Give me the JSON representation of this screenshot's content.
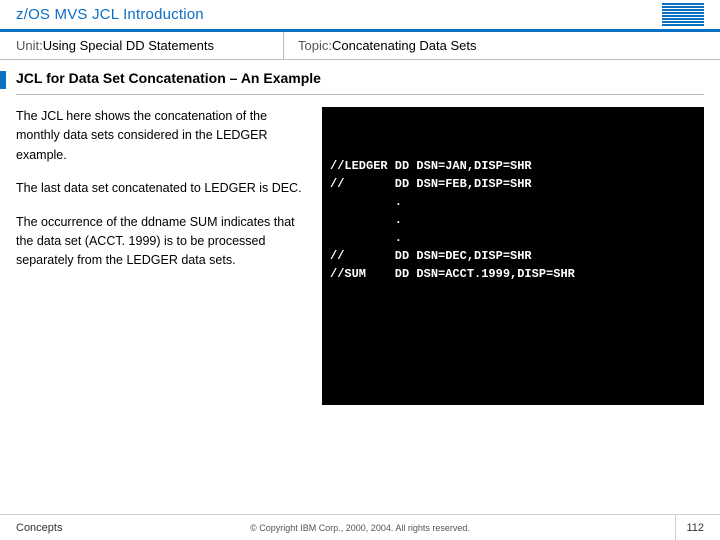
{
  "header": {
    "title": "z/OS MVS JCL Introduction"
  },
  "subtitle": {
    "unit_label": "Unit: ",
    "unit_value": "Using Special DD Statements",
    "topic_label": "Topic: ",
    "topic_value": "Concatenating Data Sets"
  },
  "section": {
    "heading": "JCL for Data Set Concatenation – An Example"
  },
  "body": {
    "p1": "The JCL here shows the concatenation of the monthly data sets considered in the LEDGER example.",
    "p2": "The last data set concatenated to LEDGER is DEC.",
    "p3": "The occurrence of the ddname SUM indicates that the data set (ACCT. 1999) is to be processed separately from the LEDGER data sets."
  },
  "terminal": {
    "text": "//LEDGER DD DSN=JAN,DISP=SHR\n//       DD DSN=FEB,DISP=SHR\n         .\n         .\n         .\n//       DD DSN=DEC,DISP=SHR\n//SUM    DD DSN=ACCT.1999,DISP=SHR"
  },
  "footer": {
    "left": "Concepts",
    "center": "© Copyright IBM Corp., 2000, 2004. All rights reserved.",
    "page": "112"
  }
}
